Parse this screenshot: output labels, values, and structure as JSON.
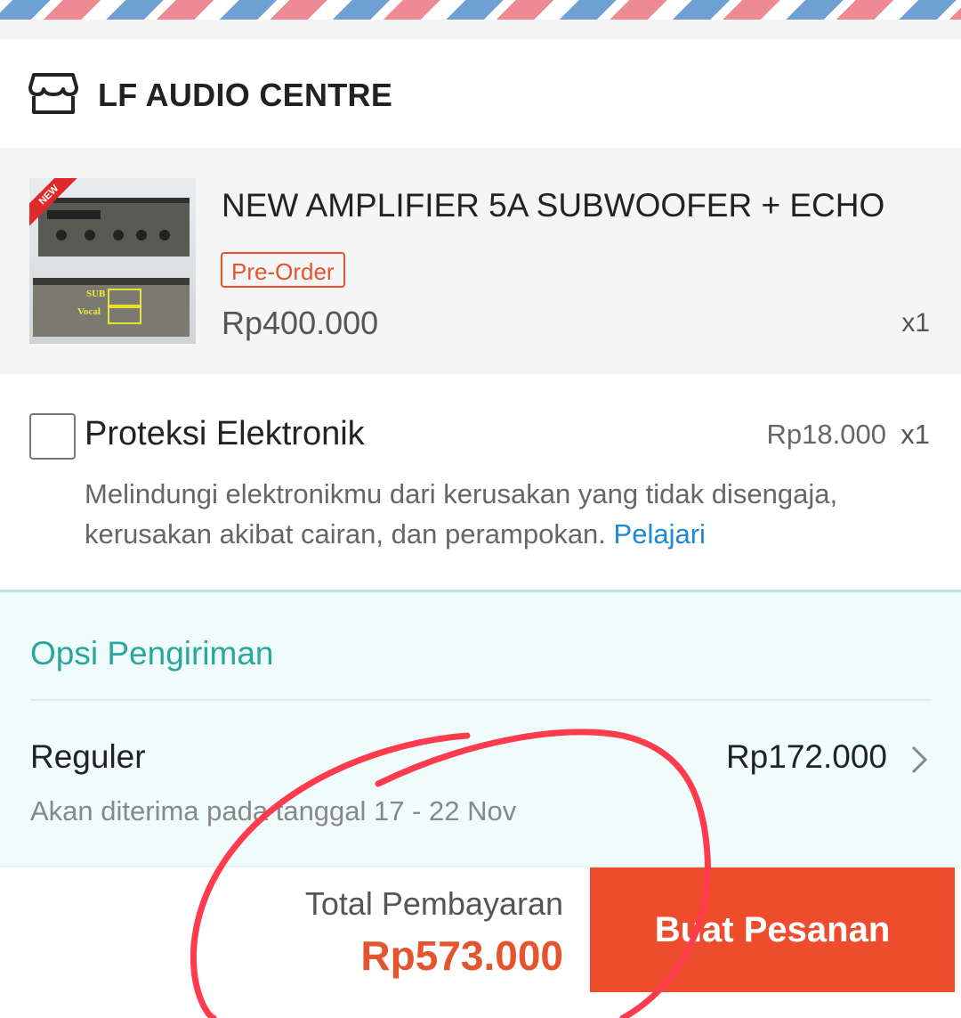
{
  "shop": {
    "name": "LF AUDIO CENTRE",
    "icon": "shop-icon"
  },
  "product": {
    "title": "NEW AMPLIFIER 5A SUBWOOFER + ECHO",
    "badge": "Pre-Order",
    "price": "Rp400.000",
    "quantity": "x1",
    "thumbnail_labels": {
      "corner": "NEW",
      "sub": "SUB",
      "vocal": "Vocal"
    }
  },
  "protection": {
    "title": "Proteksi Elektronik",
    "price": "Rp18.000",
    "quantity": "x1",
    "description": "Melindungi elektronikmu dari kerusakan yang tidak disengaja, kerusakan akibat cairan, dan perampokan.",
    "learn_more": "Pelajari",
    "checked": false
  },
  "shipping": {
    "heading": "Opsi Pengiriman",
    "method": "Reguler",
    "price": "Rp172.000",
    "eta": "Akan diterima pada tanggal 17 - 22 Nov"
  },
  "footer": {
    "total_label": "Total Pembayaran",
    "total_value": "Rp573.000",
    "order_button": "Buat Pesanan"
  },
  "colors": {
    "accent": "#ee4d2d",
    "price_accent": "#e4542f",
    "shipping_teal": "#2aa79a",
    "link_blue": "#1e88d6",
    "annotation_red": "#ff3b4e"
  }
}
